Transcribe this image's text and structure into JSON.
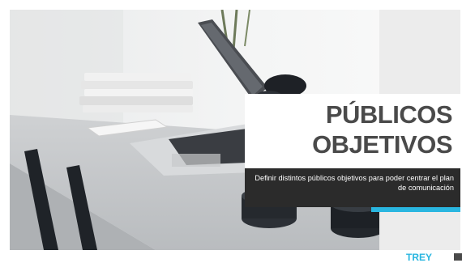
{
  "slide": {
    "title_line1": "PÚBLICOS",
    "title_line2": "OBJETIVOS",
    "subtitle": "Definir distintos públicos objetivos para poder centrar el plan de comunicación"
  },
  "footer": {
    "brand": "TREY"
  },
  "colors": {
    "accent": "#29b6e0",
    "dark": "#2b2b2b",
    "title_text": "#4a4a4a"
  },
  "icons": {
    "background": "desk-laptop-photo",
    "corner": "slide-corner-mark"
  }
}
